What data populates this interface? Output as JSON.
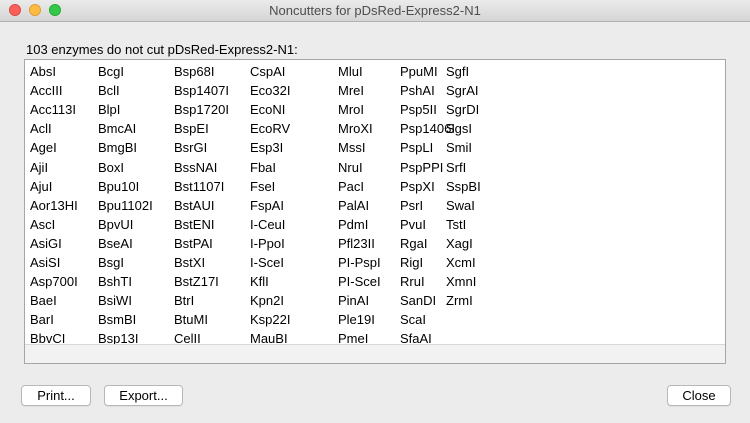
{
  "window": {
    "title": "Noncutters for pDsRed-Express2-N1"
  },
  "heading": "103 enzymes do not cut pDsRed-Express2-N1:",
  "enzymes_columns": [
    [
      "AbsI",
      "AccIII",
      "Acc113I",
      "AclI",
      "AgeI",
      "AjiI",
      "AjuI",
      "Aor13HI",
      "AscI",
      "AsiGI",
      "AsiSI",
      "Asp700I",
      "BaeI",
      "BarI",
      "BbvCI"
    ],
    [
      "BcgI",
      "BclI",
      "BlpI",
      "BmcAI",
      "BmgBI",
      "BoxI",
      "Bpu10I",
      "Bpu1102I",
      "BpvUI",
      "BseAI",
      "BsgI",
      "BshTI",
      "BsiWI",
      "BsmBI",
      "Bsp13I"
    ],
    [
      "Bsp68I",
      "Bsp1407I",
      "Bsp1720I",
      "BspEI",
      "BsrGI",
      "BssNAI",
      "Bst1107I",
      "BstAUI",
      "BstENI",
      "BstPAI",
      "BstXI",
      "BstZ17I",
      "BtrI",
      "BtuMI",
      "CelII"
    ],
    [
      "CspAI",
      "Eco32I",
      "EcoNI",
      "EcoRV",
      "Esp3I",
      "FbaI",
      "FseI",
      "FspAI",
      "I-CeuI",
      "I-PpoI",
      "I-SceI",
      "KflI",
      "Kpn2I",
      "Ksp22I",
      "MauBI"
    ],
    [
      "MluI",
      "MreI",
      "MroI",
      "MroXI",
      "MssI",
      "NruI",
      "PacI",
      "PalAI",
      "PdmI",
      "Pfl23II",
      "PI-PspI",
      "PI-SceI",
      "PinAI",
      "Ple19I",
      "PmeI"
    ],
    [
      "PpuMI",
      "PshAI",
      "Psp5II",
      "Psp1406I",
      "PspLI",
      "PspPPI",
      "PspXI",
      "PsrI",
      "PvuI",
      "RgaI",
      "RigI",
      "RruI",
      "SanDI",
      "ScaI",
      "SfaAI"
    ],
    [
      "SgfI",
      "SgrAI",
      "SgrDI",
      "SgsI",
      "SmiI",
      "SrfI",
      "SspBI",
      "SwaI",
      "TstI",
      "XagI",
      "XcmI",
      "XmnI",
      "ZrmI"
    ]
  ],
  "buttons": {
    "print": "Print...",
    "export": "Export...",
    "close": "Close"
  }
}
